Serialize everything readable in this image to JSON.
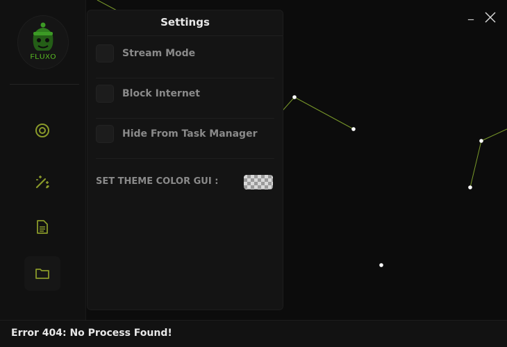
{
  "window": {
    "accent_color": "#6fa52b"
  },
  "logo": {
    "text": "FLUXO"
  },
  "sidebar": {
    "items": [
      {
        "icon": "target-icon"
      },
      {
        "icon": "magic-wand-icon"
      },
      {
        "icon": "document-icon"
      },
      {
        "icon": "folder-icon",
        "active": true
      }
    ]
  },
  "settings": {
    "title": "Settings",
    "options": [
      {
        "label": "Stream Mode",
        "checked": false
      },
      {
        "label": "Block Internet",
        "checked": false
      },
      {
        "label": "Hide From Task Manager",
        "checked": false
      }
    ],
    "theme_label": "SET THEME COLOR GUI :"
  },
  "status": {
    "text": "Error 404: No Process Found!"
  },
  "title_bar": {
    "minimize_label": "_"
  }
}
